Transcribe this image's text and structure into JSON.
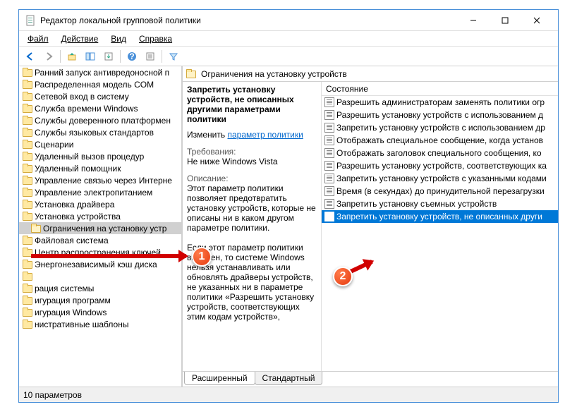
{
  "window": {
    "title": "Редактор локальной групповой политики"
  },
  "menu": {
    "file": "Файл",
    "action": "Действие",
    "view": "Вид",
    "help": "Справка"
  },
  "tree": {
    "items": [
      "Ранний запуск антивредоносной п",
      "Распределенная модель COM",
      "Сетевой вход в систему",
      "Служба времени Windows",
      "Службы доверенного платформен",
      "Службы языковых стандартов",
      "Сценарии",
      "Удаленный вызов процедур",
      "Удаленный помощник",
      "Управление связью через Интерне",
      "Управление электропитанием",
      "Установка драйвера",
      "Установка устройства",
      "Ограничения на установку устр",
      "Файловая система",
      "Центр распространения ключей",
      "Энергонезависимый кэш диска",
      "",
      "рация системы",
      "игурация программ",
      "игурация Windows",
      "нистративные шаблоны"
    ],
    "selected_index": 13
  },
  "path": {
    "label": "Ограничения на установку устройств"
  },
  "desc": {
    "title": "Запретить установку устройств, не описанных другими параметрами политики",
    "change_prefix": "Изменить",
    "change_link": "параметр политики",
    "req_label": "Требования:",
    "req_value": "Не ниже Windows Vista",
    "about_label": "Описание:",
    "about_text1": "Этот параметр политики позволяет предотвратить установку устройств, которые не описаны ни в каком другом параметре политики.",
    "about_text2": "Если этот параметр политики включен, то системе Windows нельзя устанавливать или обновлять драйверы устройств, не указанных ни в параметре политики «Разрешить установку устройств, соответствующих этим кодам устройств»,"
  },
  "list": {
    "header": "Состояние",
    "items": [
      "Разрешить администраторам заменять политики огр",
      "Разрешить установку устройств с использованием д",
      "Запретить установку устройств с использованием др",
      "Отображать специальное сообщение, когда установ",
      "Отображать заголовок специального сообщения, ко",
      "Разрешить установку устройств, соответствующих ка",
      "Запретить установку устройств с указанными кодами",
      "Время (в секундах) до принудительной перезагрузки",
      "Запретить установку съемных устройств",
      "Запретить установку устройств, не описанных други"
    ],
    "selected_index": 9
  },
  "tabs": {
    "extended": "Расширенный",
    "standard": "Стандартный"
  },
  "status": {
    "text": "10 параметров"
  },
  "badges": {
    "one": "1",
    "two": "2"
  }
}
